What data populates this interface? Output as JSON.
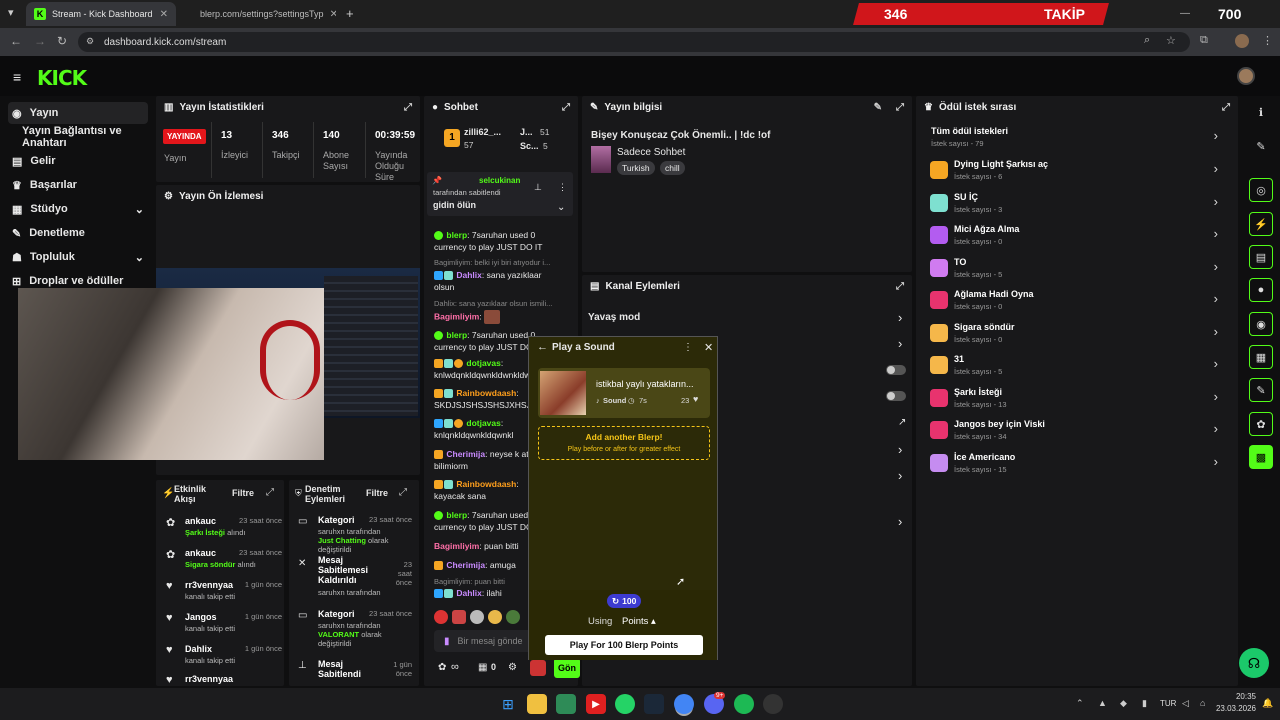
{
  "browser": {
    "tabs": [
      {
        "label": "Stream - Kick Dashboard"
      },
      {
        "label": "blerp.com/settings?settingsTyp"
      }
    ],
    "url": "dashboard.kick.com/stream"
  },
  "overlay_banner": {
    "left_count": "346",
    "label": "TAKİP",
    "right_count": "700"
  },
  "sidebar": {
    "items": [
      {
        "label": "Yayın"
      },
      {
        "label": "Yayın Bağlantısı ve Anahtarı"
      },
      {
        "label": "Gelir"
      },
      {
        "label": "Başarılar"
      },
      {
        "label": "Stüdyo"
      },
      {
        "label": "Denetleme"
      },
      {
        "label": "Topluluk"
      },
      {
        "label": "Droplar ve ödüller"
      }
    ]
  },
  "stats": {
    "title": "Yayın İstatistikleri",
    "live_badge": "YAYINDA",
    "live_label": "Yayın",
    "viewers": {
      "value": "13",
      "label": "İzleyici"
    },
    "followers": {
      "value": "346",
      "label": "Takipçi"
    },
    "subs": {
      "value": "140",
      "label": "Abone Sayısı"
    },
    "uptime": {
      "value": "00:39:59",
      "label": "Yayında Olduğu Süre"
    }
  },
  "preview": {
    "title": "Yayın Ön İzlemesi"
  },
  "activity": {
    "title": "Etkinlik Akışı",
    "filter": "Filtre",
    "events": [
      {
        "name": "ankauc",
        "time": "23 saat önce",
        "highlight": "Şarkı İsteği",
        "text": "alındı"
      },
      {
        "name": "ankauc",
        "time": "23 saat önce",
        "highlight": "Sigara söndür",
        "text": "alındı"
      },
      {
        "name": "rr3vennyaa",
        "time": "1 gün önce",
        "highlight": "",
        "text": "kanalı takip etti"
      },
      {
        "name": "Jangos",
        "time": "1 gün önce",
        "highlight": "",
        "text": "kanalı takip etti"
      },
      {
        "name": "Dahlix",
        "time": "1 gün önce",
        "highlight": "",
        "text": "kanalı takip etti"
      },
      {
        "name": "rr3vennyaa",
        "time": "",
        "highlight": "",
        "text": ""
      }
    ]
  },
  "moderation": {
    "title": "Denetim Eylemleri",
    "filter": "Filtre",
    "events": [
      {
        "title": "Kategori",
        "time": "23 saat önce",
        "line1": "saruhxn tarafından",
        "hl1": "Just Chatting",
        "line2": "olarak değiştirildi"
      },
      {
        "title": "Mesaj Sabitlemesi Kaldırıldı",
        "time": "23 saat önce",
        "line1": "saruhxn tarafından",
        "hl1": "",
        "line2": ""
      },
      {
        "title": "Kategori",
        "time": "23 saat önce",
        "line1": "saruhxn tarafından",
        "hl1": "VALORANT",
        "line2": "olarak değiştirildi"
      },
      {
        "title": "Mesaj Sabitlendi",
        "time": "1 gün önce",
        "line1": "",
        "hl1": "",
        "line2": ""
      }
    ]
  },
  "chat": {
    "title": "Sohbet",
    "top_users": [
      {
        "name": "zilli62_...",
        "count": "57"
      },
      {
        "name": "J...",
        "count": "51"
      },
      {
        "name": "Sc...",
        "count": "5"
      }
    ],
    "pinned": {
      "user": "selcukinan",
      "by": "tarafından sabitlendi",
      "message": "gidin ölün"
    },
    "messages": [
      {
        "reply": "",
        "user": "blerp",
        "text": "7saruhan used 0 currency to play JUST DO IT",
        "color": "#53fc18"
      },
      {
        "reply": "Bagimliyim: belki iyi biri atıyodur i...",
        "user": "Dahlix",
        "text": "sana yazıklaar olsun",
        "color": "#c98bff"
      },
      {
        "reply": "Dahlix: sana yazıklaar olsun ismili...",
        "user": "Bagimliyim",
        "text": "",
        "color": "#ff6fa8"
      },
      {
        "reply": "",
        "user": "blerp",
        "text": "7saruhan used 0 currency to play JUST DO",
        "color": "#53fc18"
      },
      {
        "reply": "",
        "user": "dotjavas",
        "text": "knlwdqnkldqwnkldwnkldwn",
        "color": "#53fc18"
      },
      {
        "reply": "",
        "user": "Rainbowdaash",
        "text": "SKDJSJSHSJSHSJXHSJX",
        "color": "#ff9f1c"
      },
      {
        "reply": "",
        "user": "dotjavas",
        "text": "knlqnkldqwnkldqwnkl",
        "color": "#53fc18"
      },
      {
        "reply": "",
        "user": "Cherimija",
        "text": "neyse k atmayı bilimiorm",
        "color": "#c98bff"
      },
      {
        "reply": "",
        "user": "Rainbowdaash",
        "text": "kayacak sana",
        "color": "#ff9f1c"
      },
      {
        "reply": "",
        "user": "blerp",
        "text": "7saruhan used 0 currency to play JUST DO",
        "color": "#53fc18"
      },
      {
        "reply": "",
        "user": "Bagimliyim",
        "text": "puan bitti",
        "color": "#ff6fa8"
      },
      {
        "reply": "",
        "user": "Cherimija",
        "text": "amuga",
        "color": "#c98bff"
      },
      {
        "reply": "Bagimliyim: puan bitti",
        "user": "Dahlix",
        "text": "ilahi",
        "color": "#c98bff"
      }
    ],
    "input_placeholder": "Bir mesaj gönde",
    "points": "∞",
    "count": "0",
    "send": "Gön"
  },
  "stream_info": {
    "title": "Yayın bilgisi",
    "stream_title": "Bişey Konuşcaz Çok Önemli.. | !dc !of",
    "category": "Sadece Sohbet",
    "tags": [
      "Turkish",
      "chill"
    ]
  },
  "channel_actions": {
    "title": "Kanal Eylemleri",
    "slow_mode": "Yavaş mod"
  },
  "blerp": {
    "title": "Play a Sound",
    "sound_name": "istikbal yaylı yatakların...",
    "sound_type": "Sound",
    "duration": "7s",
    "likes": "23",
    "add_title": "Add another Blerp!",
    "add_sub": "Play before or after for greater effect",
    "points": "100",
    "using": "Using",
    "points_label": "Points",
    "play_button": "Play For 100 Blerp Points"
  },
  "rewards": {
    "title": "Ödül istek sırası",
    "all": {
      "title": "Tüm ödül istekleri",
      "sub": "İstek sayısı - 79"
    },
    "items": [
      {
        "title": "Dying Light Şarkısı aç",
        "sub": "İstek sayısı - 6",
        "color": "#f5a623"
      },
      {
        "title": "SU İÇ",
        "sub": "İstek sayısı - 3",
        "color": "#7ee0d0"
      },
      {
        "title": "Mici Ağza Alma",
        "sub": "İstek sayısı - 0",
        "color": "#b35cf0"
      },
      {
        "title": "TO",
        "sub": "İstek sayısı - 5",
        "color": "#d07bf0"
      },
      {
        "title": "Ağlama Hadi Oyna",
        "sub": "İstek sayısı - 0",
        "color": "#e8336e"
      },
      {
        "title": "Sigara söndür",
        "sub": "İstek sayısı - 0",
        "color": "#f5b74a"
      },
      {
        "title": "31",
        "sub": "İstek sayısı - 5",
        "color": "#f5b74a"
      },
      {
        "title": "Şarkı İsteği",
        "sub": "İstek sayısı - 13",
        "color": "#e8336e"
      },
      {
        "title": "Jangos bey için Viski",
        "sub": "İstek sayısı - 34",
        "color": "#e8336e"
      },
      {
        "title": "İce Americano",
        "sub": "İstek sayısı - 15",
        "color": "#c58cf0"
      }
    ]
  },
  "taskbar": {
    "lang": "TUR",
    "time": "20:35",
    "date": "23.03.2026",
    "notif_count": "9+"
  },
  "colors": {
    "kick_green": "#53fc18",
    "panel": "#18181a",
    "live_red": "#e3161b"
  }
}
